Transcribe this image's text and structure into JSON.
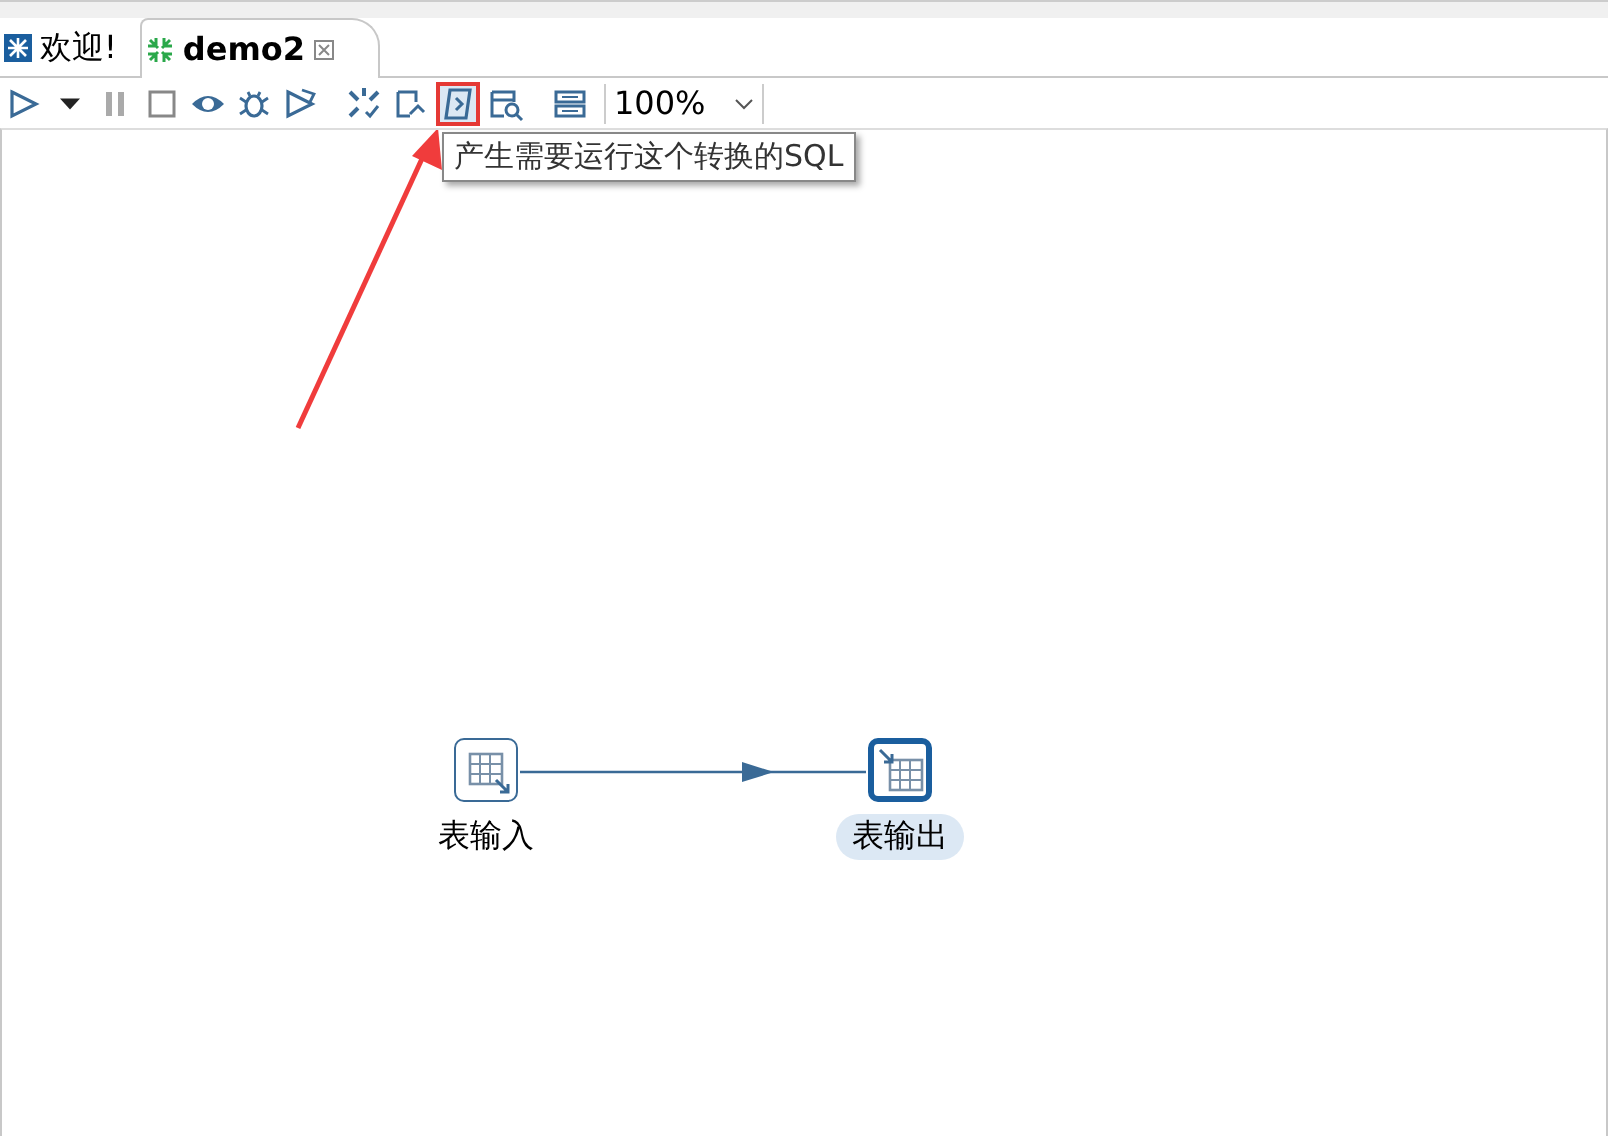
{
  "tabs": [
    {
      "label": "欢迎!",
      "selected": false,
      "kind": "welcome",
      "closable": false
    },
    {
      "label": "demo2",
      "selected": true,
      "kind": "transform",
      "closable": true
    }
  ],
  "toolbar": [
    {
      "kind": "run",
      "highlighted": false
    },
    {
      "kind": "dropdown",
      "highlighted": false
    },
    {
      "kind": "pause",
      "highlighted": false
    },
    {
      "kind": "stop",
      "highlighted": false
    },
    {
      "kind": "preview",
      "highlighted": false
    },
    {
      "kind": "debug",
      "highlighted": false
    },
    {
      "kind": "replay",
      "highlighted": false
    },
    {
      "kind": "check",
      "highlighted": false
    },
    {
      "kind": "impact",
      "highlighted": false
    },
    {
      "kind": "sql",
      "highlighted": true
    },
    {
      "kind": "explore",
      "highlighted": false
    },
    {
      "kind": "results",
      "highlighted": false
    }
  ],
  "zoom": {
    "value": "100%"
  },
  "tooltip": "产生需要运行这个转换的SQL",
  "steps": [
    {
      "label": "表输入",
      "kind": "input",
      "selected": false
    },
    {
      "label": "表输出",
      "kind": "output",
      "selected": true
    }
  ]
}
